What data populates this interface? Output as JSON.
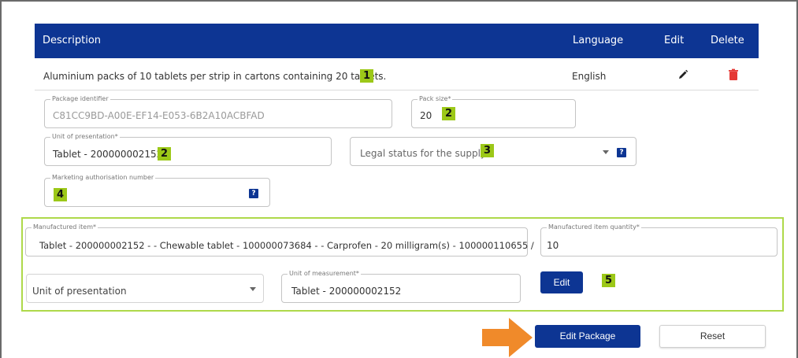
{
  "table": {
    "headers": {
      "description": "Description",
      "language": "Language",
      "edit": "Edit",
      "delete": "Delete"
    },
    "rows": [
      {
        "description": "Aluminium packs of 10 tablets per strip in cartons containing 20 tablets.",
        "language": "English",
        "edit_icon": "pencil-icon",
        "delete_icon": "trash-icon"
      }
    ]
  },
  "badges": {
    "b1": "1",
    "b2a": "2",
    "b2b": "2",
    "b3": "3",
    "b4": "4",
    "b5": "5"
  },
  "fields": {
    "package_identifier": {
      "label": "Package identifier",
      "value": "C81CC9BD-A00E-EF14-E053-6B2A10ACBFAD"
    },
    "pack_size": {
      "label": "Pack size*",
      "value": "20"
    },
    "unit_of_presentation": {
      "label": "Unit of presentation*",
      "value": "Tablet - 200000002152"
    },
    "legal_status": {
      "placeholder": "Legal status for the supply",
      "help": "?"
    },
    "marketing_authorisation_number": {
      "label": "Marketing authorisation number",
      "value": "",
      "help": "?"
    }
  },
  "manufactured": {
    "item": {
      "label": "Manufactured item*",
      "value": "Tablet - 200000002152 -  - Chewable tablet - 100000073684 -  - Carprofen - 20 milligram(s) - 100000110655 /"
    },
    "quantity": {
      "label": "Manufactured item quantity*",
      "value": "10"
    },
    "unit_select": {
      "placeholder": "Unit of presentation"
    },
    "unit_of_measurement": {
      "label": "Unit of measurement*",
      "value": "Tablet - 200000002152"
    },
    "edit_label": "Edit"
  },
  "actions": {
    "edit_package": "Edit Package",
    "reset": "Reset"
  },
  "colors": {
    "header_blue": "#0d3593",
    "badge_green": "#9cc818",
    "group_border": "#aed94a",
    "delete_red": "#e53935",
    "arrow_orange": "#f08a2a"
  }
}
